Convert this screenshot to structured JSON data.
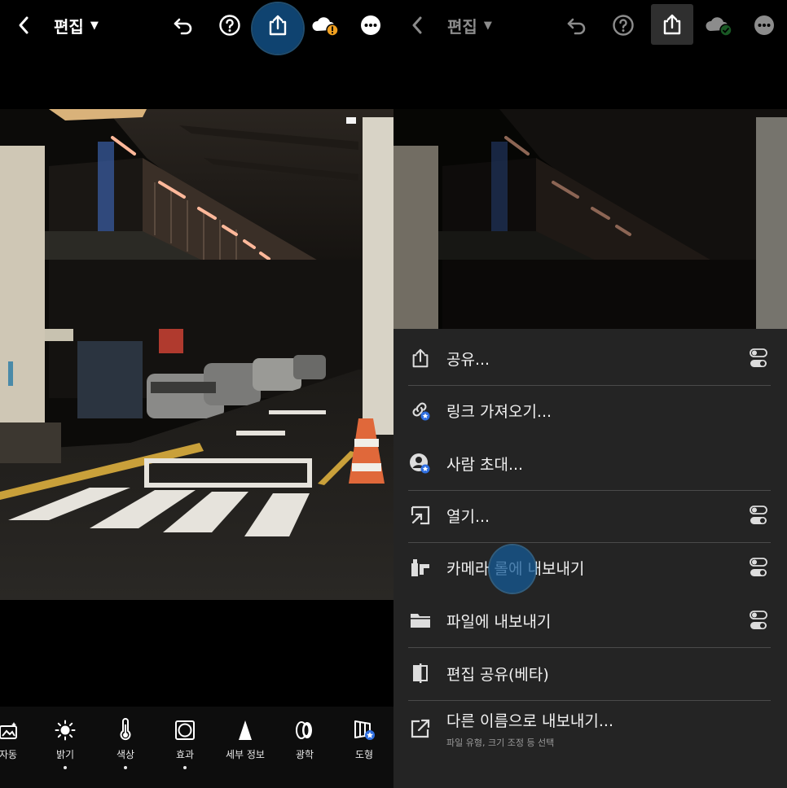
{
  "left": {
    "title": "편집",
    "tools": [
      {
        "label": "자동",
        "icon": "auto-icon",
        "dot": false
      },
      {
        "label": "밝기",
        "icon": "brightness-icon",
        "dot": true
      },
      {
        "label": "색상",
        "icon": "thermometer-icon",
        "dot": true
      },
      {
        "label": "효과",
        "icon": "effects-icon",
        "dot": true
      },
      {
        "label": "세부 정보",
        "icon": "detail-icon",
        "dot": false
      },
      {
        "label": "광학",
        "icon": "optics-icon",
        "dot": false
      },
      {
        "label": "도형",
        "icon": "geometry-icon",
        "dot": false
      }
    ]
  },
  "right": {
    "title": "편집",
    "share_menu": [
      {
        "label": "공유...",
        "icon": "share-icon",
        "toggle": true
      },
      {
        "label": "링크 가져오기...",
        "icon": "link-icon",
        "toggle": false
      },
      {
        "label": "사람 초대...",
        "icon": "invite-person-icon",
        "toggle": false
      },
      {
        "label": "열기...",
        "icon": "open-in-icon",
        "toggle": true
      },
      {
        "label": "카메라 롤에 내보내기",
        "icon": "camera-roll-icon",
        "toggle": true
      },
      {
        "label": "파일에 내보내기",
        "icon": "folder-icon",
        "toggle": true
      },
      {
        "label": "편집 공유(베타)",
        "icon": "compare-icon",
        "toggle": false
      },
      {
        "label": "다른 이름으로 내보내기...",
        "icon": "export-as-icon",
        "toggle": false,
        "sub": "파일 유형, 크기 조정 등 선택"
      }
    ]
  },
  "colors": {
    "accent_touch": "#145a96",
    "sheet_bg": "#242424",
    "warning": "#f0a020",
    "synced": "#2ea043"
  }
}
